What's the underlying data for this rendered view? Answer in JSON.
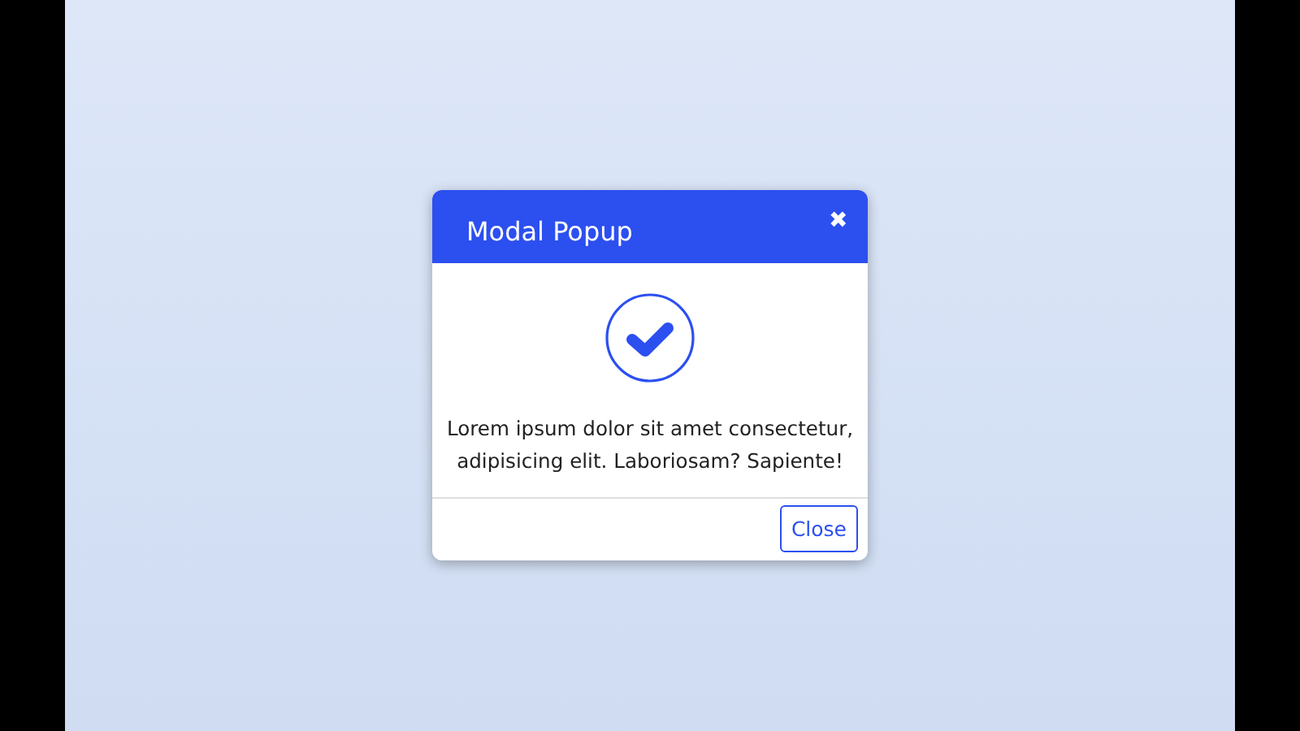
{
  "modal": {
    "title": "Modal Popup",
    "close_icon": "✖",
    "message": "Lorem ipsum dolor sit amet consectetur, adipisicing elit. Laboriosam? Sapiente!",
    "buttons": [
      "Close"
    ]
  }
}
